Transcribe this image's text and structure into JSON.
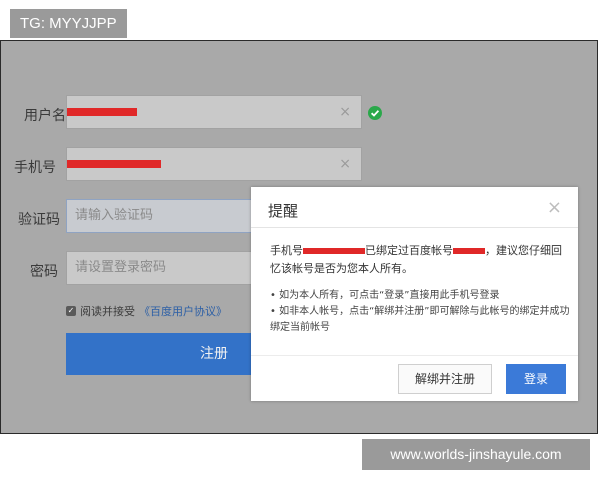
{
  "tag": "TG: MYYJJPP",
  "watermark": "www.worlds-jinshayule.com",
  "form": {
    "username_label": "用户名",
    "phone_label": "手机号",
    "code_label": "验证码",
    "code_placeholder": "请输入验证码",
    "password_label": "密码",
    "password_placeholder": "请设置登录密码",
    "agree_text": "阅读并接受",
    "agree_link": "《百度用户协议》",
    "register_label": "注册",
    "clear_glyph": "×"
  },
  "dialog": {
    "title": "提醒",
    "close_glyph": "×",
    "msg_prefix": "手机号",
    "msg_mid": "已绑定过百度帐号",
    "msg_suffix": "，建议您仔细回忆该帐号是否为您本人所有。",
    "bullet_1": "• 如为本人所有，可点击“登录”直接用此手机号登录",
    "bullet_2": "• 如非本人帐号，点击“解绑并注册”即可解除与此帐号的绑定并成功绑定当前帐号",
    "unbind_label": "解绑并注册",
    "login_label": "登录"
  },
  "colors": {
    "accent": "#3372c8",
    "redaction": "#e02828",
    "success": "#2aa84a"
  }
}
